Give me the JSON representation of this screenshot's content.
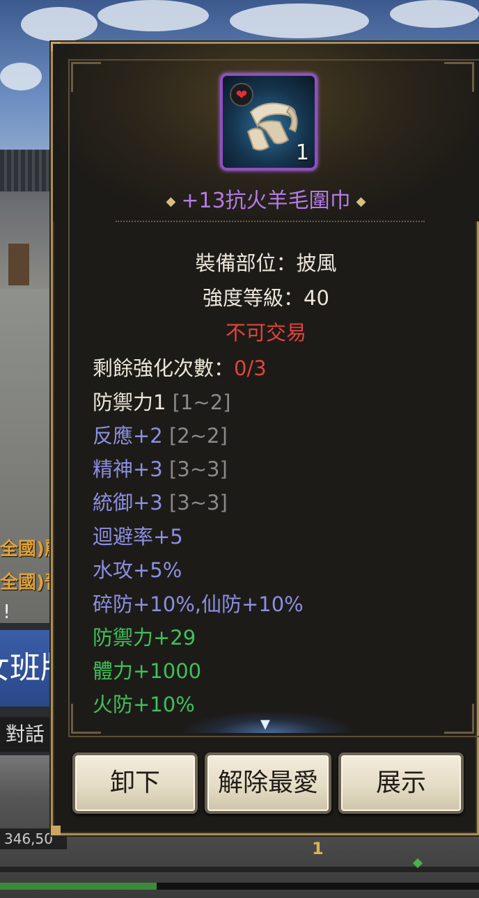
{
  "background": {
    "side_chat_lines": [
      "全國)麗",
      "全國)晉"
    ],
    "side_exclaim": "!",
    "side_banner_text": "女班版",
    "chat_tab_label": "對話",
    "coord_readout": "346,50",
    "level_marker": "1"
  },
  "item": {
    "icon": "wool-scarf-icon",
    "favorite_icon": "heart-icon",
    "count": "1",
    "name": "+13抗火羊毛圍巾",
    "rarity_color": "#b57be8"
  },
  "info": {
    "slot_line": "裝備部位：披風",
    "level_line": "強度等級：40",
    "trade_status": "不可交易"
  },
  "stats": {
    "enhance_label": "剩餘強化次數：",
    "enhance_value": "0/3",
    "defense_base": "防禦力1",
    "defense_base_range": "[1~2]",
    "reflex": "反應+2",
    "reflex_range": "[2~2]",
    "spirit": "精神+3",
    "spirit_range": "[3~3]",
    "command": "統御+3",
    "command_range": "[3~3]",
    "evasion": "迴避率+5",
    "water_atk": "水攻+5%",
    "crush_immortal": "碎防+10%,仙防+10%",
    "defense_bonus": "防禦力+29",
    "hp_bonus": "體力+1000",
    "fire_res": "火防+10%"
  },
  "buttons": {
    "unequip": "卸下",
    "unfavorite": "解除最愛",
    "show": "展示"
  },
  "colors": {
    "base_stat": "#ece6da",
    "random_stat": "#8c8fe0",
    "bonus_stat": "#3fc05a",
    "warning": "#e0443c",
    "frame_gold": "#a98f5a"
  }
}
